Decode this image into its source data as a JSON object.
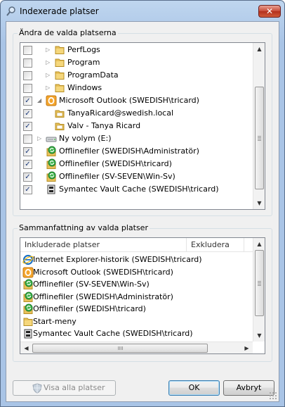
{
  "window": {
    "title": "Indexerade platser",
    "close": "✕"
  },
  "top_group": {
    "label": "Ändra de valda platserna",
    "items": [
      {
        "checked": false,
        "expander": "▷",
        "icon": "folder",
        "label": "PerfLogs",
        "level": 1
      },
      {
        "checked": false,
        "expander": "▷",
        "icon": "folder",
        "label": "Program",
        "level": 1
      },
      {
        "checked": false,
        "expander": "▷",
        "icon": "folder",
        "label": "ProgramData",
        "level": 1
      },
      {
        "checked": false,
        "expander": "▷",
        "icon": "folder",
        "label": "Windows",
        "level": 1
      },
      {
        "checked": true,
        "expander": "◢",
        "icon": "outlook",
        "label": "Microsoft Outlook (SWEDISH\\tricard)",
        "level": 0
      },
      {
        "checked": true,
        "expander": "",
        "icon": "mailfolder",
        "label": "TanyaRicard@swedish.local",
        "level": 1
      },
      {
        "checked": true,
        "expander": "",
        "icon": "mailfolder",
        "label": "Valv - Tanya Ricard",
        "level": 1
      },
      {
        "checked": false,
        "expander": "▷",
        "icon": "drive",
        "label": "Ny volym (E:)",
        "level": 0
      },
      {
        "checked": true,
        "expander": "",
        "icon": "offline",
        "label": "Offlinefiler (SWEDISH\\Administratör)",
        "level": 0
      },
      {
        "checked": true,
        "expander": "",
        "icon": "offline",
        "label": "Offlinefiler (SWEDISH\\tricard)",
        "level": 0
      },
      {
        "checked": true,
        "expander": "",
        "icon": "offline",
        "label": "Offlinefiler (SV-SEVEN\\Win-Sv)",
        "level": 0
      },
      {
        "checked": true,
        "expander": "",
        "icon": "vault",
        "label": "Symantec Vault Cache (SWEDISH\\tricard)",
        "level": 0
      }
    ]
  },
  "bottom_group": {
    "label": "Sammanfattning av valda platser",
    "columns": [
      "Inkluderade platser",
      "Exkludera"
    ],
    "rows": [
      {
        "icon": "ie",
        "label": "Internet Explorer-historik (SWEDISH\\tricard)",
        "exclude": ""
      },
      {
        "icon": "outlook",
        "label": "Microsoft Outlook (SWEDISH\\tricard)",
        "exclude": ""
      },
      {
        "icon": "offline",
        "label": "Offlinefiler (SV-SEVEN\\Win-Sv)",
        "exclude": ""
      },
      {
        "icon": "offline",
        "label": "Offlinefiler (SWEDISH\\Administratör)",
        "exclude": ""
      },
      {
        "icon": "offline",
        "label": "Offlinefiler (SWEDISH\\tricard)",
        "exclude": ""
      },
      {
        "icon": "folder",
        "label": "Start-meny",
        "exclude": ""
      },
      {
        "icon": "vault",
        "label": "Symantec Vault Cache (SWEDISH\\tricard)",
        "exclude": ""
      }
    ]
  },
  "buttons": {
    "show_all": "Visa alla platser",
    "ok": "OK",
    "cancel": "Avbryt"
  },
  "scroll_arrows": {
    "up": "▲",
    "down": "▼",
    "left": "◀",
    "right": "▶"
  }
}
